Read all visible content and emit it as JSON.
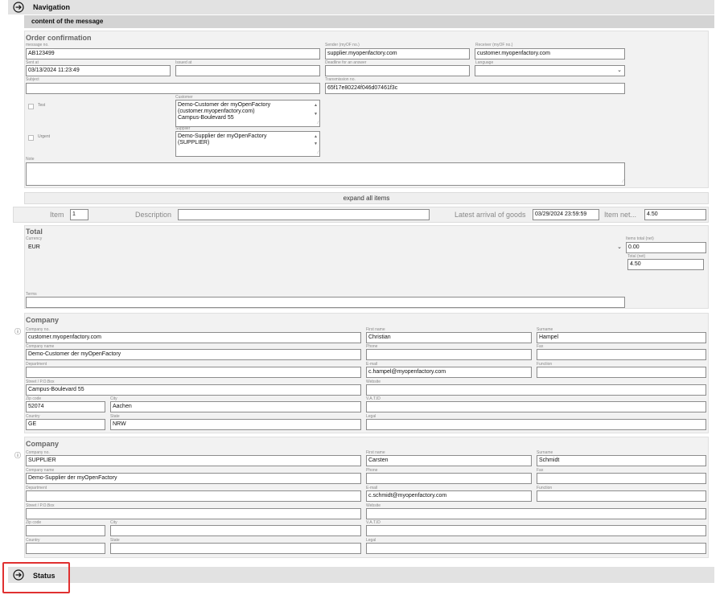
{
  "nav": {
    "title": "Navigation",
    "subtitle": "content of the message"
  },
  "order": {
    "title": "Order confirmation",
    "message_no_label": "message no.",
    "message_no": "AB123499",
    "sender_label": "Sender (myOF no.)",
    "sender": "supplier.myopenfactory.com",
    "receiver_label": "Receiver (myOF no.)",
    "receiver": "customer.myopenfactory.com",
    "sent_at_label": "Sent at",
    "sent_at": "03/13/2024 11:23:49",
    "issued_at_label": "Issued at",
    "issued_at": "",
    "deadline_label": "Deadline for an answer",
    "deadline": "",
    "language_label": "Language",
    "language": "",
    "subject_label": "Subject",
    "subject": "",
    "transmission_label": "Transmission no.",
    "transmission": "65f17e80224f046d07461f3c",
    "test_label": "Test",
    "urgent_label": "Urgent",
    "customer_label": "Customer",
    "customer_lines": [
      "Demo-Customer der myOpenFactory",
      "(customer.myopenfactory.com)",
      "Campus-Boulevard 55"
    ],
    "supplier_label": "Supplier",
    "supplier_lines": [
      "Demo-Supplier der myOpenFactory",
      "(SUPPLIER)"
    ],
    "note_label": "Note",
    "note": ""
  },
  "expand_label": "expand all items",
  "item_row": {
    "item_label": "Item",
    "item_value": "1",
    "description_label": "Description",
    "description_value": "",
    "arrival_label": "Latest arrival of goods",
    "arrival_value": "03/29/2024 23:59:59",
    "net_label": "Item net...",
    "net_value": "4.50"
  },
  "total": {
    "title": "Total",
    "currency_label": "Currency",
    "currency": "EUR",
    "items_total_label": "Items total (net)",
    "items_total": "0.00",
    "total_net_label": "Total (net)",
    "total_net": "4.50",
    "terms_label": "Terms",
    "terms": ""
  },
  "companies": [
    {
      "title": "Company",
      "company_no_label": "Company no.",
      "company_no": "customer.myopenfactory.com",
      "company_name_label": "Company name",
      "company_name": "Demo-Customer der myOpenFactory",
      "department_label": "Department",
      "department": "",
      "street_label": "Street / P.O.Box",
      "street": "Campus-Boulevard 55",
      "zip_label": "Zip code",
      "zip": "52074",
      "city_label": "City",
      "city": "Aachen",
      "country_label": "Country",
      "country": "GE",
      "state_label": "State",
      "state": "NRW",
      "first_name_label": "First name",
      "first_name": "Christian",
      "surname_label": "Surname",
      "surname": "Hampel",
      "phone_label": "Phone",
      "phone": "",
      "fax_label": "Fax",
      "fax": "",
      "email_label": "E-mail",
      "email": "c.hampel@myopenfactory.com",
      "function_label": "Function",
      "function": "",
      "website_label": "Website",
      "website": "",
      "vat_label": "V.A.T.ID",
      "vat": "",
      "legal_label": "Legal",
      "legal": ""
    },
    {
      "title": "Company",
      "company_no_label": "Company no.",
      "company_no": "SUPPLIER",
      "company_name_label": "Company name",
      "company_name": "Demo-Supplier der myOpenFactory",
      "department_label": "Department",
      "department": "",
      "street_label": "Street / P.O.Box",
      "street": "",
      "zip_label": "Zip code",
      "zip": "",
      "city_label": "City",
      "city": "",
      "country_label": "Country",
      "country": "",
      "state_label": "State",
      "state": "",
      "first_name_label": "First name",
      "first_name": "Carsten",
      "surname_label": "Surname",
      "surname": "Schmidt",
      "phone_label": "Phone",
      "phone": "",
      "fax_label": "Fax",
      "fax": "",
      "email_label": "E-mail",
      "email": "c.schmidt@myopenfactory.com",
      "function_label": "Function",
      "function": "",
      "website_label": "Website",
      "website": "",
      "vat_label": "V.A.T.ID",
      "vat": "",
      "legal_label": "Legal",
      "legal": ""
    }
  ],
  "status": {
    "title": "Status"
  },
  "colors": {
    "highlight": "#e03030",
    "bar": "#e2e2e2",
    "panel": "#f2f2f2"
  }
}
